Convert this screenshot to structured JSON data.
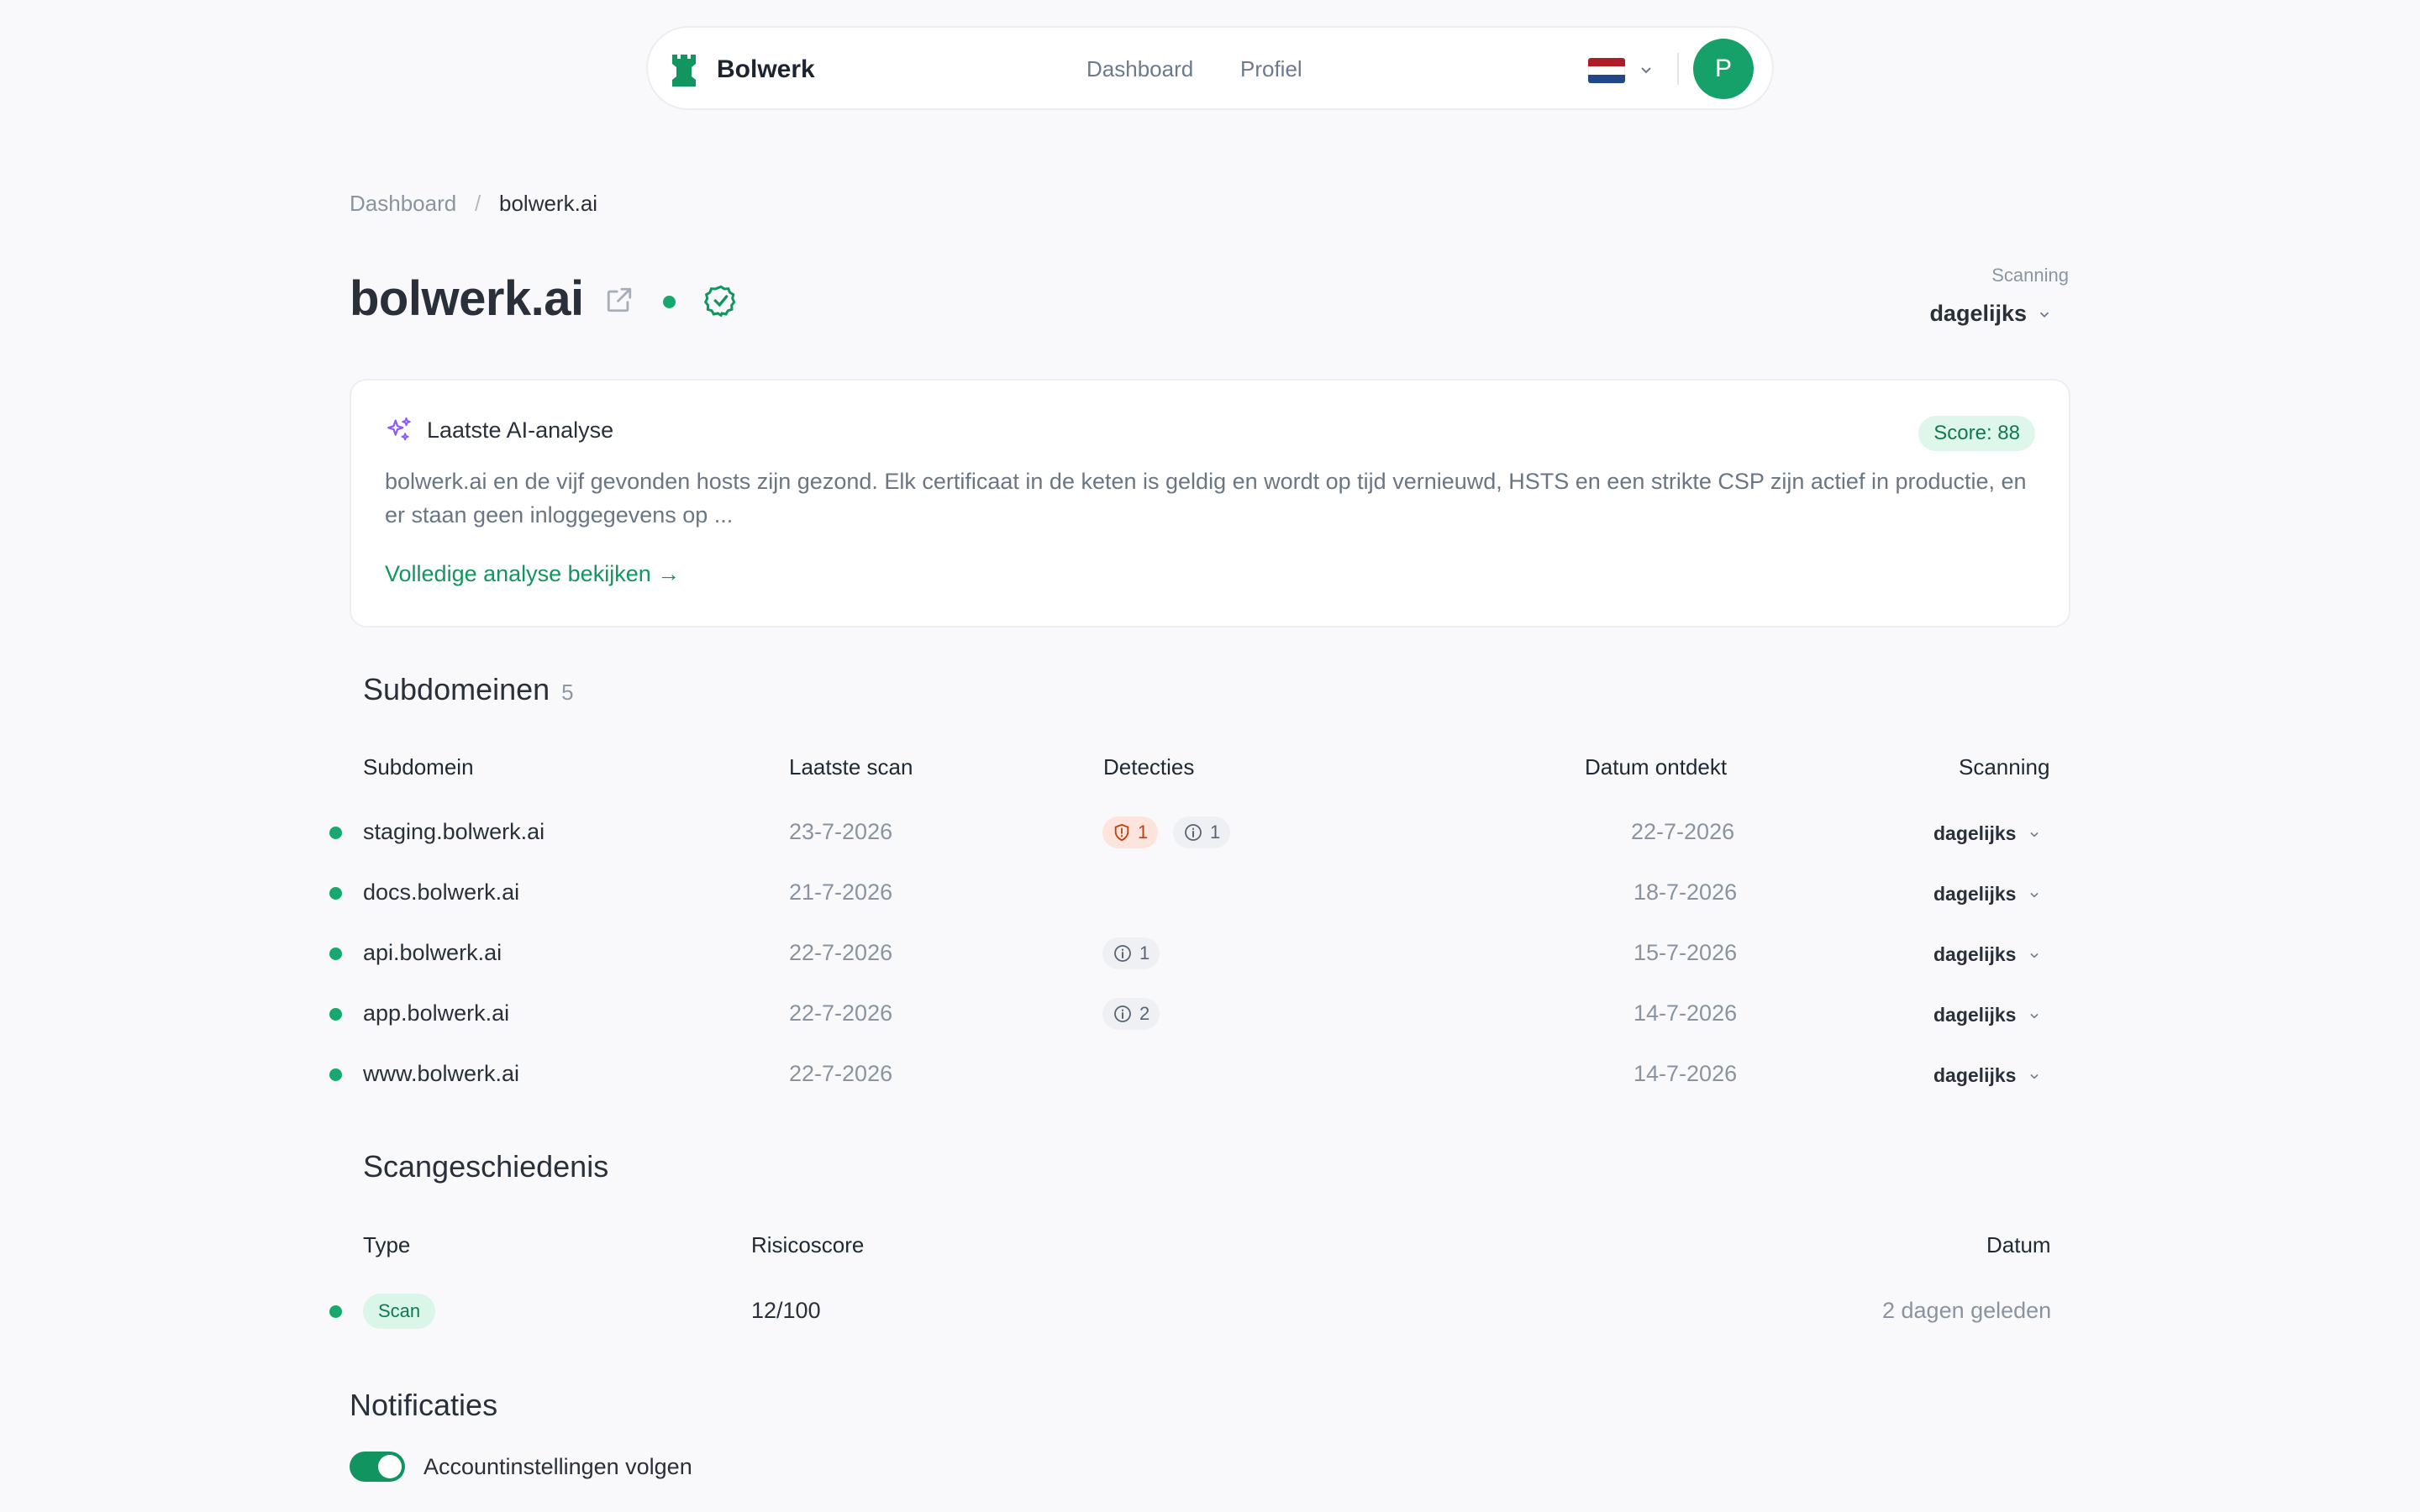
{
  "nav": {
    "brand": "Bolwerk",
    "links": [
      "Dashboard",
      "Profiel"
    ],
    "avatar_initial": "P",
    "flag_colors": [
      "#ae1c28",
      "#ffffff",
      "#21468b"
    ]
  },
  "breadcrumb": {
    "parent": "Dashboard",
    "separator": "/",
    "current": "bolwerk.ai"
  },
  "header": {
    "title": "bolwerk.ai",
    "scanning_label": "Scanning",
    "scanning_value": "dagelijks"
  },
  "ai": {
    "heading": "Laatste AI-analyse",
    "score": "Score: 88",
    "text": "bolwerk.ai en de vijf gevonden hosts zijn gezond. Elk certificaat in de keten is geldig en wordt op tijd vernieuwd, HSTS en een strikte CSP zijn actief in productie, en er staan geen inloggegevens op ...",
    "link": "Volledige analyse bekijken →"
  },
  "subdomains": {
    "title": "Subdomeinen",
    "count": "5",
    "headers": [
      "Subdomein",
      "Laatste scan",
      "Detecties",
      "Datum ontdekt",
      "Scanning"
    ],
    "rows": [
      {
        "name": "staging.bolwerk.ai",
        "last_scan": "23-7-2026",
        "alert": "1",
        "info": "1",
        "discovered": "22-7-2026",
        "scanning": "dagelijks"
      },
      {
        "name": "docs.bolwerk.ai",
        "last_scan": "21-7-2026",
        "alert": null,
        "info": null,
        "discovered": "18-7-2026",
        "scanning": "dagelijks"
      },
      {
        "name": "api.bolwerk.ai",
        "last_scan": "22-7-2026",
        "alert": null,
        "info": "1",
        "discovered": "15-7-2026",
        "scanning": "dagelijks"
      },
      {
        "name": "app.bolwerk.ai",
        "last_scan": "22-7-2026",
        "alert": null,
        "info": "2",
        "discovered": "14-7-2026",
        "scanning": "dagelijks"
      },
      {
        "name": "www.bolwerk.ai",
        "last_scan": "22-7-2026",
        "alert": null,
        "info": null,
        "discovered": "14-7-2026",
        "scanning": "dagelijks"
      }
    ]
  },
  "history": {
    "title": "Scangeschiedenis",
    "headers": [
      "Type",
      "Risicoscore",
      "Datum"
    ],
    "rows": [
      {
        "type": "Scan",
        "risk": "12/100",
        "date": "2 dagen geleden"
      }
    ]
  },
  "notifications": {
    "title": "Notificaties",
    "toggle_label": "Accountinstellingen volgen",
    "toggle_on": true
  },
  "colors": {
    "accent": "#16a06a",
    "alert": "#c2410c",
    "ai_icon": "#8b5cf6"
  }
}
